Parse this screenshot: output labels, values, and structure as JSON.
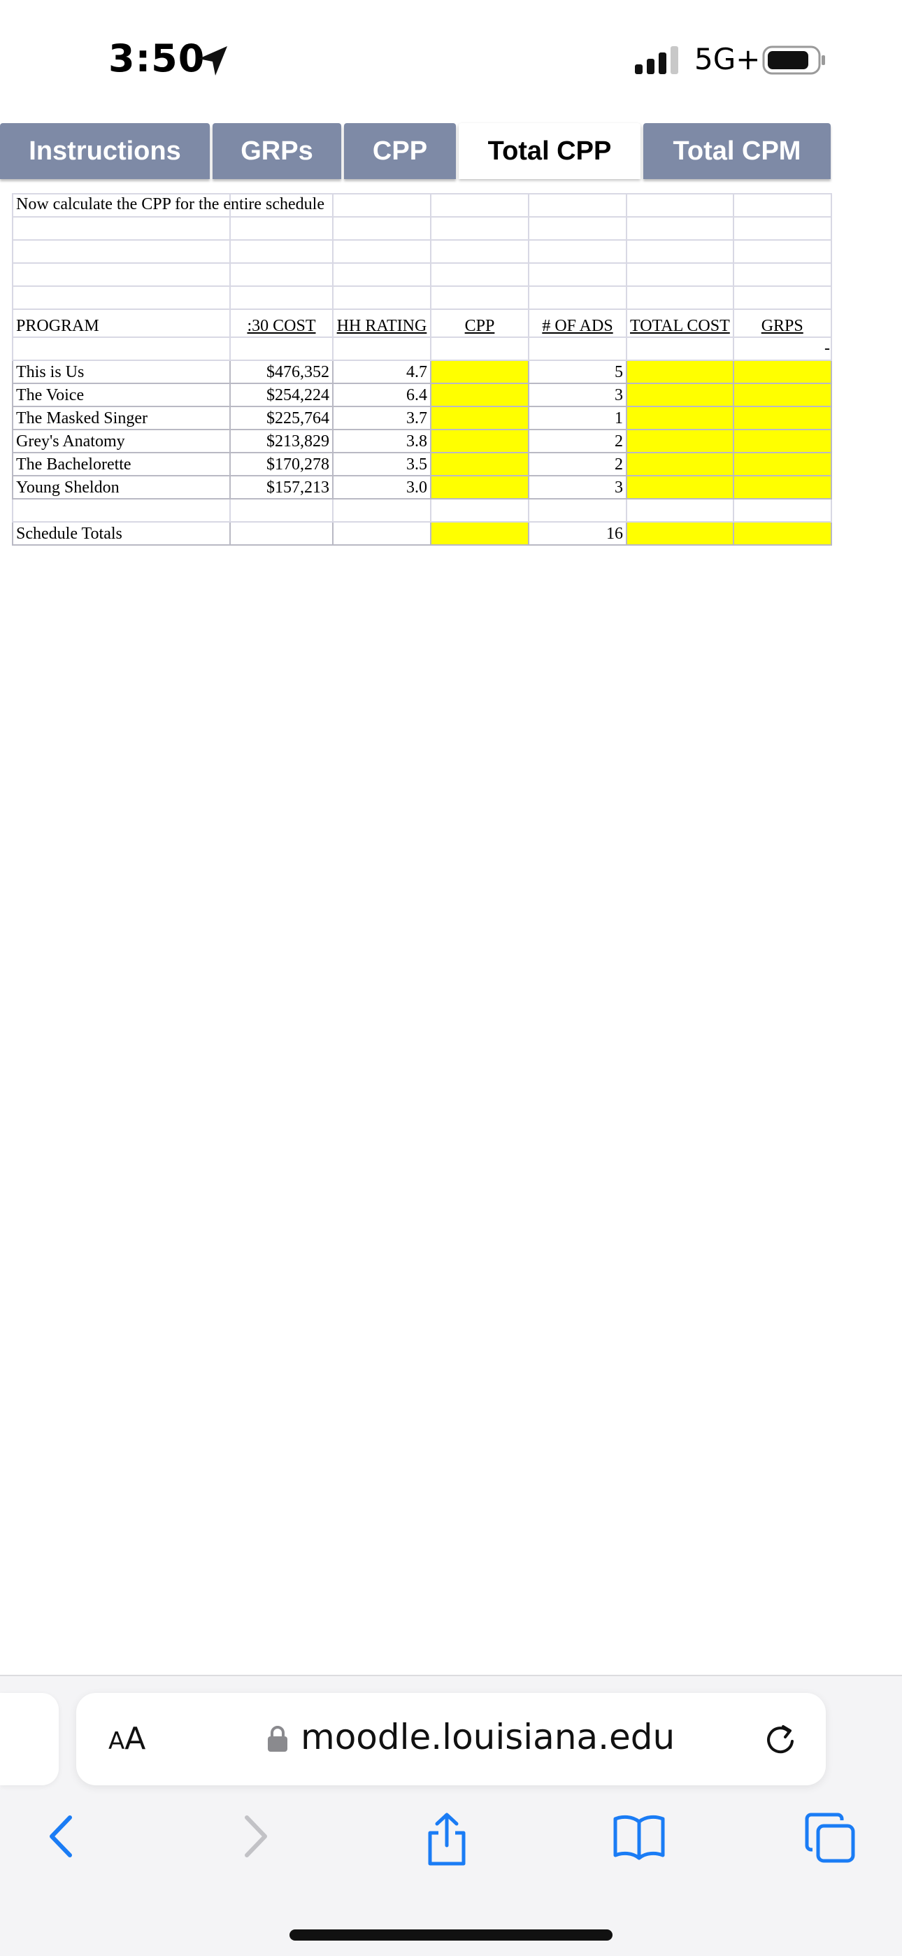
{
  "status_bar": {
    "time": "3:50",
    "network": "5G+",
    "icons": [
      "location-arrow-icon",
      "signal-icon",
      "battery-icon"
    ]
  },
  "tabs": [
    {
      "label": "Instructions",
      "active": false
    },
    {
      "label": "GRPs",
      "active": false
    },
    {
      "label": "CPP",
      "active": false
    },
    {
      "label": "Total CPP",
      "active": true
    },
    {
      "label": "Total CPM",
      "active": false
    }
  ],
  "sheet": {
    "instruction": "Now calculate the CPP for the entire schedule",
    "headers": {
      "program": "PROGRAM",
      "cost": ":30 COST",
      "rating": "HH RATING",
      "cpp": "CPP",
      "ads": "# OF ADS",
      "total_cost": "TOTAL COST",
      "grps": "GRPS"
    },
    "trailing_mark": "-",
    "rows": [
      {
        "program": "This is Us",
        "cost": "$476,352",
        "rating": "4.7",
        "ads": "5"
      },
      {
        "program": "The Voice",
        "cost": "$254,224",
        "rating": "6.4",
        "ads": "3"
      },
      {
        "program": "The Masked Singer",
        "cost": "$225,764",
        "rating": "3.7",
        "ads": "1"
      },
      {
        "program": "Grey's Anatomy",
        "cost": "$213,829",
        "rating": "3.8",
        "ads": "2"
      },
      {
        "program": "The Bachelorette",
        "cost": "$170,278",
        "rating": "3.5",
        "ads": "2"
      },
      {
        "program": "Young Sheldon",
        "cost": "$157,213",
        "rating": "3.0",
        "ads": "3"
      }
    ],
    "totals": {
      "label": "Schedule Totals",
      "ads": "16"
    },
    "highlight_color": "#ffff00"
  },
  "browser": {
    "aa_label_big": "A",
    "aa_label_small": "A",
    "url": "moodle.louisiana.edu",
    "accent_color": "#1a7cf5"
  }
}
